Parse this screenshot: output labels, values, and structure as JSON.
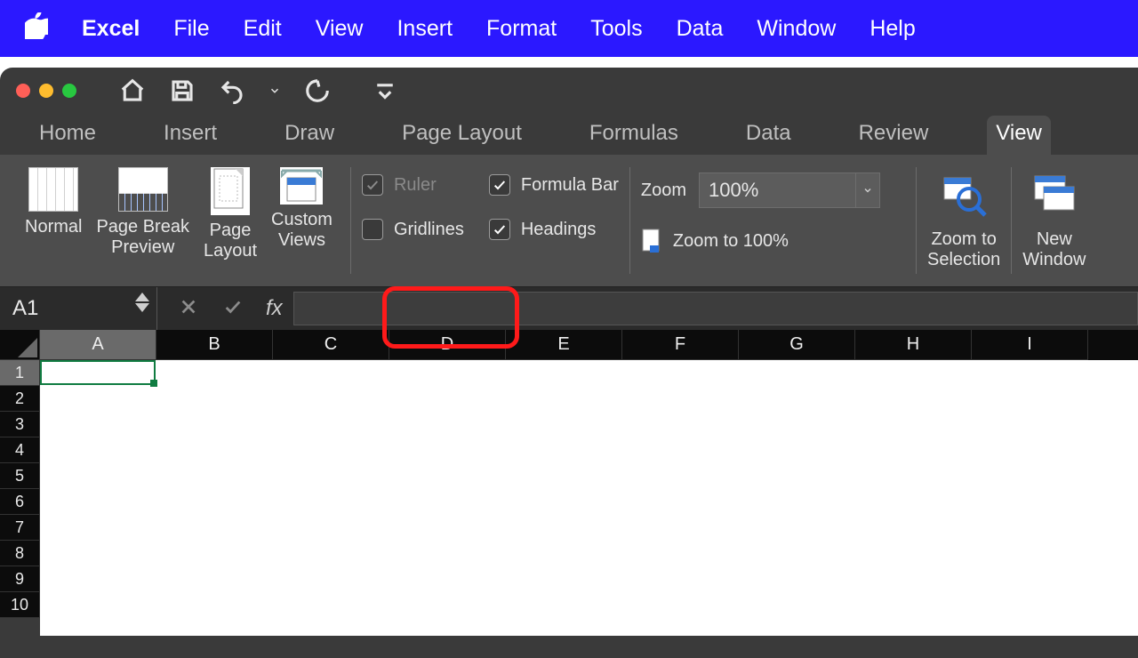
{
  "menubar": {
    "app_name": "Excel",
    "items": [
      "File",
      "Edit",
      "View",
      "Insert",
      "Format",
      "Tools",
      "Data",
      "Window",
      "Help"
    ]
  },
  "ribbon": {
    "tabs": [
      "Home",
      "Insert",
      "Draw",
      "Page Layout",
      "Formulas",
      "Data",
      "Review",
      "View"
    ],
    "active_tab": "View",
    "views": {
      "normal": "Normal",
      "page_break": "Page Break\nPreview",
      "page_layout": "Page\nLayout",
      "custom_views": "Custom\nViews"
    },
    "show": {
      "ruler_label": "Ruler",
      "gridlines_label": "Gridlines",
      "formula_bar_label": "Formula Bar",
      "headings_label": "Headings",
      "ruler_checked": true,
      "ruler_enabled": false,
      "gridlines_checked": false,
      "formula_bar_checked": true,
      "headings_checked": true
    },
    "zoom": {
      "label": "Zoom",
      "value": "100%",
      "zoom_to_100": "Zoom to 100%",
      "zoom_to_selection": "Zoom to\nSelection"
    },
    "window": {
      "new_window": "New\nWindow"
    }
  },
  "formula_bar": {
    "name_box": "A1",
    "fx_label": "fx",
    "formula_value": ""
  },
  "sheet": {
    "columns": [
      "A",
      "B",
      "C",
      "D",
      "E",
      "F",
      "G",
      "H",
      "I"
    ],
    "rows": [
      "1",
      "2",
      "3",
      "4",
      "5",
      "6",
      "7",
      "8",
      "9",
      "10"
    ],
    "selected_cell": "A1"
  }
}
